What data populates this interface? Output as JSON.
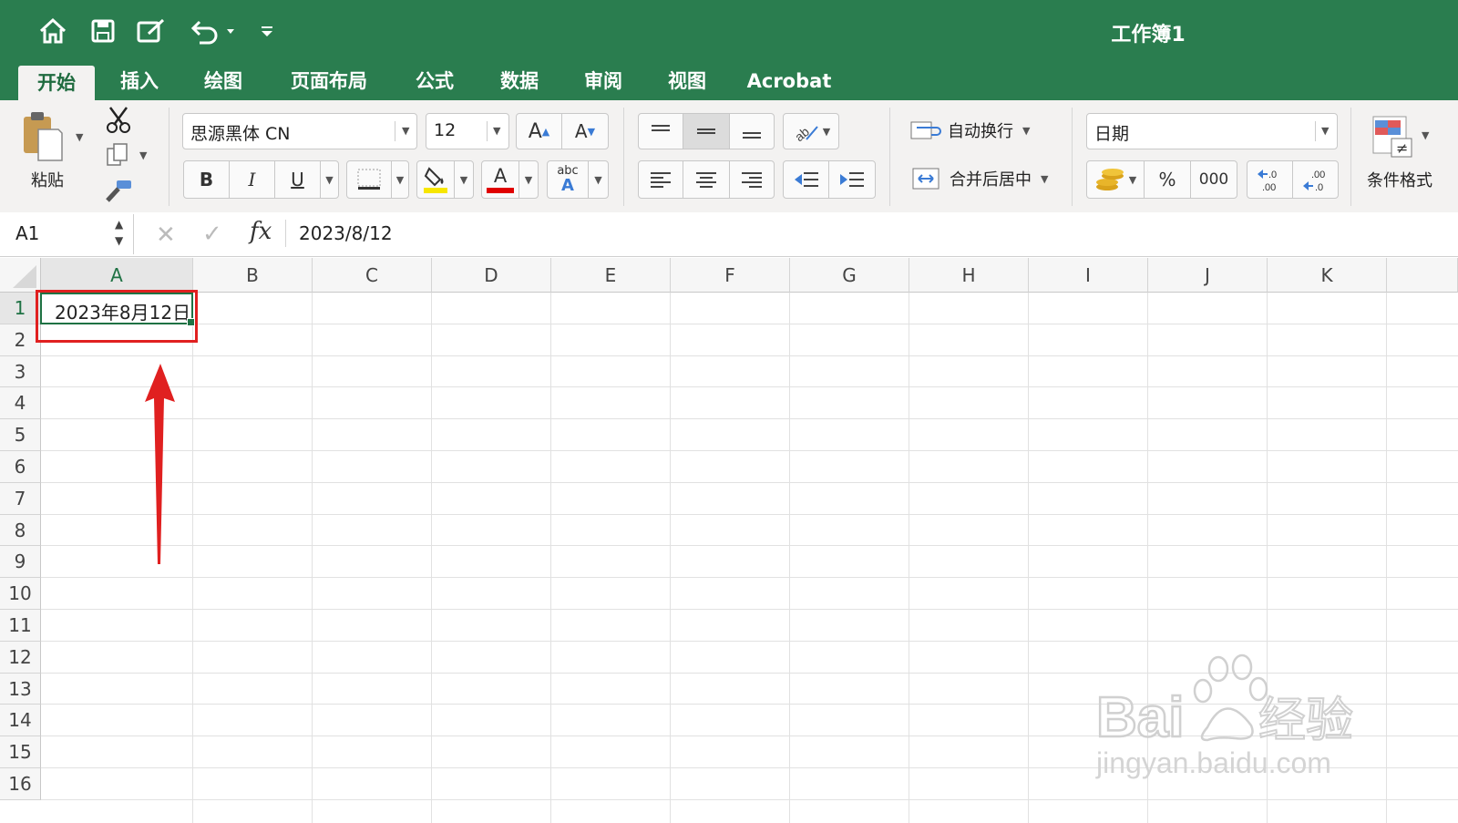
{
  "title_bar": {
    "workbook_title": "工作簿1",
    "icons": [
      "home-icon",
      "save-icon",
      "edit-icon",
      "undo-icon",
      "customize-icon"
    ]
  },
  "tabs": [
    {
      "label": "开始",
      "active": true
    },
    {
      "label": "插入"
    },
    {
      "label": "绘图"
    },
    {
      "label": "页面布局"
    },
    {
      "label": "公式"
    },
    {
      "label": "数据"
    },
    {
      "label": "审阅"
    },
    {
      "label": "视图"
    },
    {
      "label": "Acrobat"
    }
  ],
  "ribbon": {
    "paste_label": "粘贴",
    "font_name": "思源黑体 CN",
    "font_size": "12",
    "bold": "B",
    "italic": "I",
    "underline": "U",
    "font_color_letter": "A",
    "abc_label": "abc",
    "wrap_text_label": "自动换行",
    "merge_center_label": "合并后居中",
    "number_format": "日期",
    "percent_label": "%",
    "thousands_label": "000",
    "conditional_format_label": "条件格式",
    "accent_colors": {
      "highlight": "#f7e600",
      "font_color": "#e00000"
    }
  },
  "formula_bar": {
    "name_box": "A1",
    "fx_label": "fx",
    "content": "2023/8/12"
  },
  "sheet": {
    "columns": [
      "A",
      "B",
      "C",
      "D",
      "E",
      "F",
      "G",
      "H",
      "I",
      "J",
      "K"
    ],
    "rows": [
      "1",
      "2",
      "3",
      "4",
      "5",
      "6",
      "7",
      "8",
      "9",
      "10",
      "11",
      "12",
      "13",
      "14",
      "15",
      "16"
    ],
    "active_cell": "A1",
    "cells": {
      "A1": "2023年8月12日"
    }
  },
  "annotation": {
    "color": "#e02020"
  },
  "watermark": {
    "brand": "Baidu经验",
    "url": "jingyan.baidu.com"
  }
}
